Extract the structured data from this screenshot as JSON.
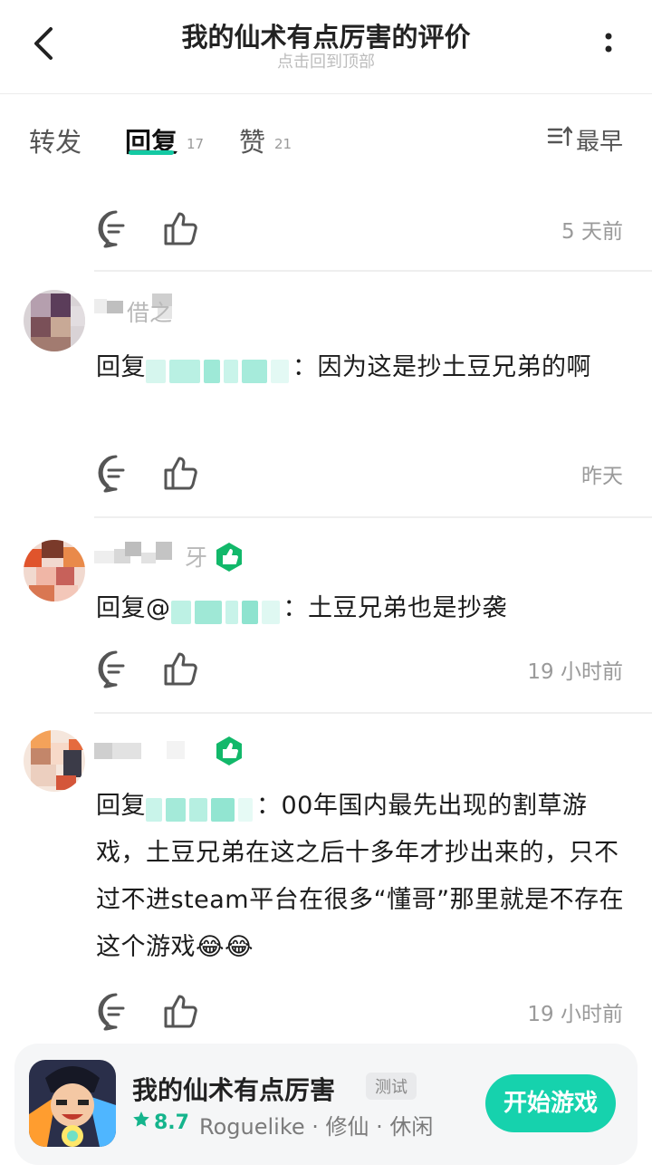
{
  "header": {
    "title": "我的仙术有点厉害的评价",
    "subtitle": "点击回到顶部"
  },
  "tabs": [
    {
      "label": "转发",
      "count": ""
    },
    {
      "label": "回复",
      "count": "17"
    },
    {
      "label": "赞",
      "count": "21"
    }
  ],
  "sort": {
    "label": "最早"
  },
  "comments": [
    {
      "time": "5 天前"
    },
    {
      "name_tail": "借之",
      "prefix": "回复",
      "body": "：因为这是抄土豆兄弟的啊",
      "time": "昨天"
    },
    {
      "name_tail": "牙",
      "prefix": "回复@",
      "body": "：土豆兄弟也是抄袭",
      "time": "19 小时前"
    },
    {
      "name_tail": "",
      "prefix": "回复",
      "body": "：00年国内最先出现的割草游戏，土豆兄弟在这之后十多年才抄出来的，只不过不进steam平台在很多“懂哥”那里就是不存在这个游戏😂😂",
      "time": "19 小时前"
    }
  ],
  "game_card": {
    "name": "我的仙术有点厉害",
    "tag": "测试",
    "rating": "8.7",
    "categories": "Roguelike · 修仙 · 休闲",
    "play_label": "开始游戏"
  },
  "colors": {
    "accent": "#16d2ad",
    "badge": "#12b86a"
  }
}
